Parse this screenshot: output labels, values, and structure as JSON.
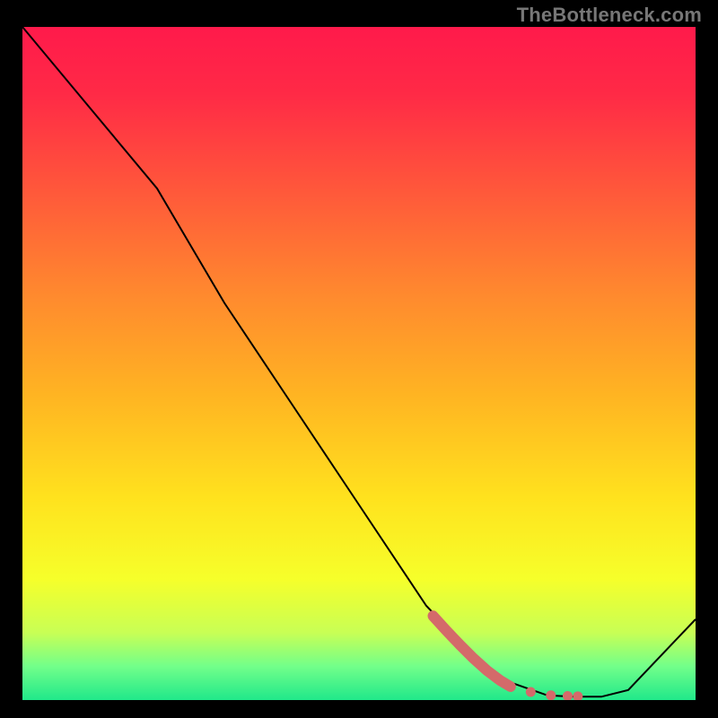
{
  "watermark": "TheBottleneck.com",
  "chart_data": {
    "type": "line",
    "title": "",
    "xlabel": "",
    "ylabel": "",
    "xlim": [
      0,
      100
    ],
    "ylim": [
      0,
      100
    ],
    "grid": false,
    "series": [
      {
        "name": "curve",
        "color": "#000000",
        "x": [
          0,
          10,
          20,
          30,
          40,
          50,
          60,
          70,
          78,
          82,
          86,
          90,
          100
        ],
        "y": [
          100,
          88,
          76,
          59,
          44,
          29,
          14,
          3.5,
          0.7,
          0.5,
          0.5,
          1.5,
          12
        ]
      }
    ],
    "highlight_segment": {
      "color": "#d46a6a",
      "x": [
        61,
        63,
        65,
        67,
        69,
        71,
        72.5
      ],
      "y": [
        12.5,
        10.3,
        8.2,
        6.2,
        4.4,
        2.9,
        2.0
      ]
    },
    "highlight_dots": {
      "color": "#d46a6a",
      "points": [
        {
          "x": 75.5,
          "y": 1.2
        },
        {
          "x": 78.5,
          "y": 0.7
        },
        {
          "x": 81.0,
          "y": 0.6
        },
        {
          "x": 82.5,
          "y": 0.55
        }
      ]
    },
    "gradient_stops": [
      {
        "offset": 0.0,
        "color": "#ff1a4b"
      },
      {
        "offset": 0.1,
        "color": "#ff2a46"
      },
      {
        "offset": 0.25,
        "color": "#ff5a3a"
      },
      {
        "offset": 0.4,
        "color": "#ff8a2e"
      },
      {
        "offset": 0.55,
        "color": "#ffb522"
      },
      {
        "offset": 0.7,
        "color": "#ffe21e"
      },
      {
        "offset": 0.82,
        "color": "#f6ff2a"
      },
      {
        "offset": 0.9,
        "color": "#c8ff55"
      },
      {
        "offset": 0.95,
        "color": "#72ff8a"
      },
      {
        "offset": 1.0,
        "color": "#20e88a"
      }
    ]
  }
}
